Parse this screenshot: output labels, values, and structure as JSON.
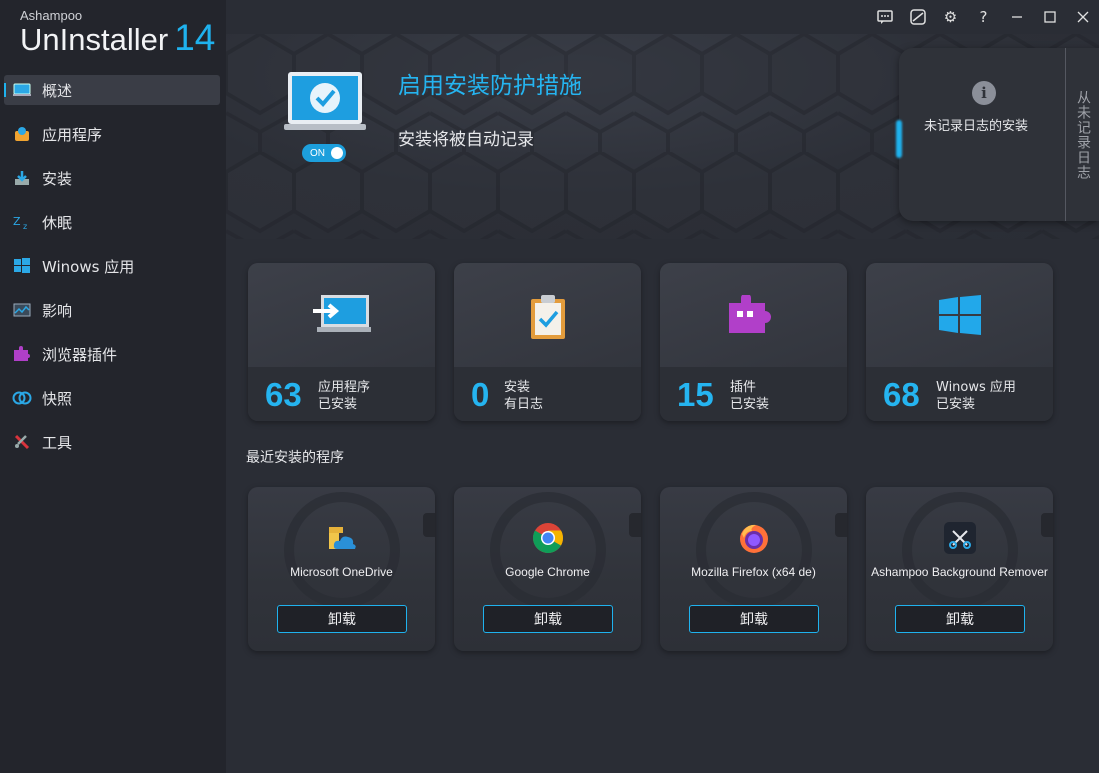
{
  "brand": {
    "small": "Ashampoo",
    "name": "UnInstaller",
    "version": "14"
  },
  "nav": {
    "items": [
      {
        "label": "概述",
        "icon": "monitor-icon"
      },
      {
        "label": "应用程序",
        "icon": "apps-icon"
      },
      {
        "label": "安装",
        "icon": "install-icon"
      },
      {
        "label": "休眠",
        "icon": "sleep-icon"
      },
      {
        "label": "Winows 应用",
        "icon": "windows-icon"
      },
      {
        "label": "影响",
        "icon": "impact-icon"
      },
      {
        "label": "浏览器插件",
        "icon": "puzzle-icon"
      },
      {
        "label": "快照",
        "icon": "snapshot-icon"
      },
      {
        "label": "工具",
        "icon": "tools-icon"
      }
    ]
  },
  "hero": {
    "title": "启用安装防护措施",
    "subtitle": "安装将被自动记录",
    "toggle": "ON"
  },
  "side_panel": {
    "label": "未记录日志的安装",
    "vertical": "从未记录日志"
  },
  "tiles": [
    {
      "value": "63",
      "line1": "应用程序",
      "line2": "已安装",
      "icon": "monitor-arrow-icon"
    },
    {
      "value": "0",
      "line1": "安装",
      "line2": "有日志",
      "icon": "clipboard-check-icon"
    },
    {
      "value": "15",
      "line1": "插件",
      "line2": "已安装",
      "icon": "puzzle-icon"
    },
    {
      "value": "68",
      "line1": "Winows 应用",
      "line2": "已安装",
      "icon": "windows-logo-icon"
    }
  ],
  "recent": {
    "title": "最近安装的程序",
    "apps": [
      {
        "name": "Microsoft OneDrive",
        "button": "卸载",
        "icon": "onedrive-icon"
      },
      {
        "name": "Google Chrome",
        "button": "卸载",
        "icon": "chrome-icon"
      },
      {
        "name": "Mozilla Firefox (x64 de)",
        "button": "卸载",
        "icon": "firefox-icon"
      },
      {
        "name": "Ashampoo Background Remover",
        "button": "卸载",
        "icon": "scissors-icon"
      }
    ]
  },
  "colors": {
    "accent": "#1fb2ee",
    "sidebar": "#23252c",
    "background": "#2a2d35"
  }
}
